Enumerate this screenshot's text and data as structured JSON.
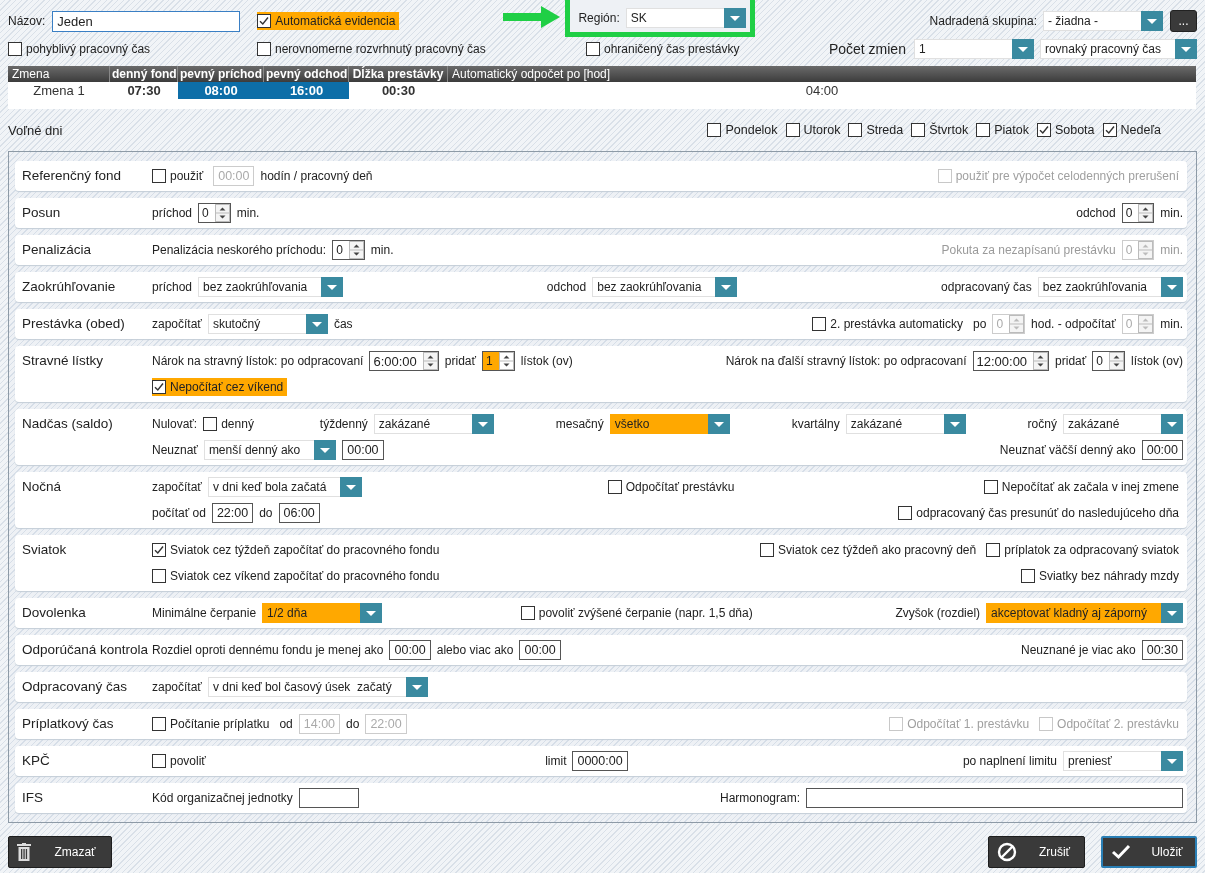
{
  "top": {
    "name_label": "Názov:",
    "name_value": "Jeden",
    "auto_evidence": {
      "label": "Automatická evidencia",
      "checked": true,
      "highlighted": true
    },
    "region": {
      "label": "Región:",
      "value": "SK",
      "marked": true
    },
    "parent_group": {
      "label": "Nadradená skupina:",
      "value": "- žiadna -",
      "button": "..."
    },
    "options": [
      {
        "label": "pohyblivý pracovný čas",
        "checked": false
      },
      {
        "label": "nerovnomerne rozvrhnutý pracovný čas",
        "checked": false
      },
      {
        "label": "ohraničený čas prestávky",
        "checked": false
      }
    ],
    "shift_count": {
      "label": "Počet zmien",
      "value": "1",
      "mode": "rovnaký pracovný čas"
    }
  },
  "shifts": {
    "columns": [
      "Zmena",
      "denný fond",
      "pevný príchod",
      "pevný odchod",
      "Dĺžka prestávky",
      "Automatický odpočet po [hod]"
    ],
    "rows": [
      {
        "cells": [
          {
            "text": "Zmena 1",
            "highlighted": false
          },
          {
            "text": "07:30",
            "highlighted": false
          },
          {
            "text": "08:00",
            "highlighted": true
          },
          {
            "text": "16:00",
            "highlighted": true
          },
          {
            "text": "00:30",
            "highlighted": false
          },
          {
            "text": "04:00",
            "highlighted": false
          }
        ]
      }
    ]
  },
  "free_days": {
    "label": "Voľné dni",
    "days": [
      {
        "label": "Pondelok",
        "checked": false
      },
      {
        "label": "Utorok",
        "checked": false
      },
      {
        "label": "Streda",
        "checked": false
      },
      {
        "label": "Štvrtok",
        "checked": false
      },
      {
        "label": "Piatok",
        "checked": false
      },
      {
        "label": "Sobota",
        "checked": true
      },
      {
        "label": "Nedeľa",
        "checked": true
      }
    ]
  },
  "sections": [
    {
      "title": "Referenčný fond",
      "lines": [
        {
          "groups": [
            {
              "items": [
                {
                  "kind": "check",
                  "label": "použiť",
                  "checked": false,
                  "disabled": false
                },
                {
                  "kind": "time",
                  "value": "00:00",
                  "disabled": true
                },
                {
                  "kind": "text",
                  "text": "hodín / pracovný deň"
                }
              ]
            },
            {
              "items": [
                {
                  "kind": "check",
                  "label": "použiť pre výpočet celodenných prerušení",
                  "checked": false,
                  "disabled": true
                }
              ]
            }
          ]
        }
      ]
    },
    {
      "title": "Posun",
      "lines": [
        {
          "groups": [
            {
              "items": [
                {
                  "kind": "text",
                  "text": "príchod"
                },
                {
                  "kind": "spin",
                  "value": "0",
                  "disabled": false,
                  "highlighted": false
                },
                {
                  "kind": "text",
                  "text": "min."
                }
              ]
            },
            {
              "items": [
                {
                  "kind": "text",
                  "text": "odchod"
                },
                {
                  "kind": "spin",
                  "value": "0",
                  "disabled": false,
                  "highlighted": false
                },
                {
                  "kind": "text",
                  "text": "min."
                }
              ]
            }
          ]
        }
      ]
    },
    {
      "title": "Penalizácia",
      "lines": [
        {
          "groups": [
            {
              "items": [
                {
                  "kind": "text",
                  "text": "Penalizácia neskorého príchodu:"
                },
                {
                  "kind": "spin",
                  "value": "0",
                  "disabled": false,
                  "highlighted": false
                },
                {
                  "kind": "text",
                  "text": "min."
                }
              ]
            },
            {
              "items": [
                {
                  "kind": "dim",
                  "text": "Pokuta za nezapísanú prestávku"
                },
                {
                  "kind": "spin",
                  "value": "0",
                  "disabled": true,
                  "highlighted": false
                },
                {
                  "kind": "dim",
                  "text": "min."
                }
              ]
            }
          ]
        }
      ]
    },
    {
      "title": "Zaokrúhľovanie",
      "lines": [
        {
          "groups": [
            {
              "items": [
                {
                  "kind": "text",
                  "text": "príchod"
                },
                {
                  "kind": "select",
                  "value": "bez zaokrúhľovania",
                  "highlighted": false
                }
              ]
            },
            {
              "items": [
                {
                  "kind": "text",
                  "text": "odchod"
                },
                {
                  "kind": "select",
                  "value": "bez zaokrúhľovania",
                  "highlighted": false
                }
              ]
            },
            {
              "items": [
                {
                  "kind": "text",
                  "text": "odpracovaný čas"
                },
                {
                  "kind": "select",
                  "value": "bez zaokrúhľovania",
                  "highlighted": false
                }
              ]
            }
          ]
        }
      ]
    },
    {
      "title": "Prestávka (obed)",
      "lines": [
        {
          "groups": [
            {
              "items": [
                {
                  "kind": "text",
                  "text": "započítať"
                },
                {
                  "kind": "select",
                  "value": "skutočný",
                  "highlighted": false
                },
                {
                  "kind": "text",
                  "text": "čas"
                }
              ]
            },
            {
              "items": [
                {
                  "kind": "check",
                  "label": "2. prestávka automaticky",
                  "checked": false,
                  "disabled": false
                },
                {
                  "kind": "text",
                  "text": "po"
                },
                {
                  "kind": "spin",
                  "value": "0",
                  "disabled": true,
                  "highlighted": false
                },
                {
                  "kind": "text",
                  "text": "hod. - odpočítať"
                },
                {
                  "kind": "spin",
                  "value": "0",
                  "disabled": true,
                  "highlighted": false
                },
                {
                  "kind": "text",
                  "text": "min."
                }
              ]
            }
          ]
        }
      ]
    },
    {
      "title": "Stravné lístky",
      "lines": [
        {
          "groups": [
            {
              "items": [
                {
                  "kind": "text",
                  "text": "Nárok na stravný lístok: po odpracovaní"
                },
                {
                  "kind": "spin",
                  "value": "6:00:00",
                  "disabled": false,
                  "highlighted": false
                },
                {
                  "kind": "text",
                  "text": "pridať"
                },
                {
                  "kind": "spin",
                  "value": "1",
                  "disabled": false,
                  "highlighted": true
                },
                {
                  "kind": "text",
                  "text": "lístok (ov)"
                }
              ]
            },
            {
              "items": [
                {
                  "kind": "text",
                  "text": "Nárok na ďalší stravný lístok: po odpracovaní"
                },
                {
                  "kind": "spin",
                  "value": "12:00:00",
                  "disabled": false,
                  "highlighted": false
                },
                {
                  "kind": "text",
                  "text": "pridať"
                },
                {
                  "kind": "spin",
                  "value": "0",
                  "disabled": false,
                  "highlighted": false
                },
                {
                  "kind": "text",
                  "text": "lístok (ov)"
                }
              ]
            }
          ]
        },
        {
          "groups": [
            {
              "items": [
                {
                  "kind": "check",
                  "label": "Nepočítať cez víkend",
                  "checked": true,
                  "disabled": false,
                  "highlighted": true
                }
              ]
            }
          ]
        }
      ]
    },
    {
      "title": "Nadčas (saldo)",
      "lines": [
        {
          "groups": [
            {
              "items": [
                {
                  "kind": "text",
                  "text": "Nulovať:"
                },
                {
                  "kind": "check",
                  "label": "denný",
                  "checked": false,
                  "disabled": false
                }
              ]
            },
            {
              "items": [
                {
                  "kind": "text",
                  "text": "týždenný"
                },
                {
                  "kind": "select",
                  "value": "zakázané",
                  "highlighted": false
                }
              ]
            },
            {
              "items": [
                {
                  "kind": "text",
                  "text": "mesačný"
                },
                {
                  "kind": "select",
                  "value": "všetko",
                  "highlighted": true
                }
              ]
            },
            {
              "items": [
                {
                  "kind": "text",
                  "text": "kvartálny"
                },
                {
                  "kind": "select",
                  "value": "zakázané",
                  "highlighted": false
                }
              ]
            },
            {
              "items": [
                {
                  "kind": "text",
                  "text": "ročný"
                },
                {
                  "kind": "select",
                  "value": "zakázané",
                  "highlighted": false
                }
              ]
            }
          ]
        },
        {
          "groups": [
            {
              "items": [
                {
                  "kind": "text",
                  "text": "Neuznať"
                },
                {
                  "kind": "select",
                  "value": "menší denný ako",
                  "highlighted": false
                },
                {
                  "kind": "time",
                  "value": "00:00",
                  "disabled": false
                }
              ]
            },
            {
              "items": [
                {
                  "kind": "text",
                  "text": "Neuznať väčší denný ako"
                },
                {
                  "kind": "time",
                  "value": "00:00",
                  "disabled": false
                }
              ]
            }
          ]
        }
      ]
    },
    {
      "title": "Nočná",
      "lines": [
        {
          "groups": [
            {
              "items": [
                {
                  "kind": "text",
                  "text": "započítať"
                },
                {
                  "kind": "select",
                  "value": "v dni keď bola začatá",
                  "highlighted": false
                }
              ]
            },
            {
              "items": [
                {
                  "kind": "check",
                  "label": "Odpočítať prestávku",
                  "checked": false,
                  "disabled": false
                }
              ]
            },
            {
              "items": [
                {
                  "kind": "check",
                  "label": "Nepočítať ak začala v inej zmene",
                  "checked": false,
                  "disabled": false
                }
              ]
            }
          ]
        },
        {
          "groups": [
            {
              "items": [
                {
                  "kind": "text",
                  "text": "počítať od"
                },
                {
                  "kind": "time",
                  "value": "22:00",
                  "disabled": false
                },
                {
                  "kind": "text",
                  "text": "do"
                },
                {
                  "kind": "time",
                  "value": "06:00",
                  "disabled": false
                }
              ]
            },
            {
              "items": [
                {
                  "kind": "check",
                  "label": "odpracovaný čas presunúť do nasledujúceho dňa",
                  "checked": false,
                  "disabled": false
                }
              ]
            }
          ]
        }
      ]
    },
    {
      "title": "Sviatok",
      "lines": [
        {
          "groups": [
            {
              "items": [
                {
                  "kind": "check",
                  "label": "Sviatok cez týždeň započítať do pracovného fondu",
                  "checked": true,
                  "disabled": false
                }
              ]
            },
            {
              "items": [
                {
                  "kind": "check",
                  "label": "Sviatok cez týždeň ako pracovný deň",
                  "checked": false,
                  "disabled": false
                },
                {
                  "kind": "check",
                  "label": "príplatok za odpracovaný sviatok",
                  "checked": false,
                  "disabled": false
                }
              ]
            }
          ]
        },
        {
          "groups": [
            {
              "items": [
                {
                  "kind": "check",
                  "label": "Sviatok cez víkend započítať do pracovného fondu",
                  "checked": false,
                  "disabled": false
                }
              ]
            },
            {
              "items": [
                {
                  "kind": "check",
                  "label": "Sviatky bez náhrady mzdy",
                  "checked": false,
                  "disabled": false
                }
              ]
            }
          ]
        }
      ]
    },
    {
      "title": "Dovolenka",
      "lines": [
        {
          "groups": [
            {
              "items": [
                {
                  "kind": "text",
                  "text": "Minimálne čerpanie"
                },
                {
                  "kind": "select",
                  "value": "1/2 dňa",
                  "highlighted": true
                }
              ]
            },
            {
              "items": [
                {
                  "kind": "check",
                  "label": "povoliť zvýšené čerpanie (napr. 1,5 dňa)",
                  "checked": false,
                  "disabled": false
                }
              ]
            },
            {
              "items": [
                {
                  "kind": "text",
                  "text": "Zvyšok (rozdiel)"
                },
                {
                  "kind": "select",
                  "value": "akceptovať kladný aj záporný",
                  "highlighted": true
                }
              ]
            }
          ]
        }
      ]
    },
    {
      "title": "Odporúčaná kontrola",
      "lines": [
        {
          "groups": [
            {
              "items": [
                {
                  "kind": "text",
                  "text": "Rozdiel oproti dennému fondu je menej ako"
                },
                {
                  "kind": "time",
                  "value": "00:00",
                  "disabled": false
                },
                {
                  "kind": "text",
                  "text": "alebo viac ako"
                },
                {
                  "kind": "time",
                  "value": "00:00",
                  "disabled": false
                }
              ]
            },
            {
              "items": [
                {
                  "kind": "text",
                  "text": "Neuznané je viac ako"
                },
                {
                  "kind": "time",
                  "value": "00:30",
                  "disabled": false
                }
              ]
            }
          ]
        }
      ]
    },
    {
      "title": "Odpracovaný čas",
      "lines": [
        {
          "groups": [
            {
              "items": [
                {
                  "kind": "text",
                  "text": "započítať"
                },
                {
                  "kind": "select",
                  "value": "v dni keď bol časový úsek  začatý",
                  "highlighted": false
                }
              ]
            }
          ]
        }
      ]
    },
    {
      "title": "Príplatkový čas",
      "lines": [
        {
          "groups": [
            {
              "items": [
                {
                  "kind": "check",
                  "label": "Počítanie príplatku",
                  "checked": false,
                  "disabled": false
                },
                {
                  "kind": "text",
                  "text": "od"
                },
                {
                  "kind": "time",
                  "value": "14:00",
                  "disabled": true
                },
                {
                  "kind": "text",
                  "text": "do"
                },
                {
                  "kind": "time",
                  "value": "22:00",
                  "disabled": true
                }
              ]
            },
            {
              "items": [
                {
                  "kind": "check",
                  "label": "Odpočítať 1. prestávku",
                  "checked": false,
                  "disabled": true
                },
                {
                  "kind": "check",
                  "label": "Odpočítať 2. prestávku",
                  "checked": false,
                  "disabled": true
                }
              ]
            }
          ]
        }
      ]
    },
    {
      "title": "KPČ",
      "lines": [
        {
          "groups": [
            {
              "items": [
                {
                  "kind": "check",
                  "label": "povoliť",
                  "checked": false,
                  "disabled": false
                }
              ]
            },
            {
              "items": [
                {
                  "kind": "text",
                  "text": "limit"
                },
                {
                  "kind": "time",
                  "value": "0000:00",
                  "disabled": false
                }
              ]
            },
            {
              "items": [
                {
                  "kind": "text",
                  "text": "po naplnení limitu"
                },
                {
                  "kind": "select",
                  "value": "preniesť",
                  "highlighted": false
                }
              ]
            }
          ]
        }
      ]
    },
    {
      "title": "IFS",
      "lines": [
        {
          "groups": [
            {
              "items": [
                {
                  "kind": "text",
                  "text": "Kód organizačnej jednotky"
                },
                {
                  "kind": "field"
                }
              ]
            },
            {
              "items": [
                {
                  "kind": "text",
                  "text": "Harmonogram:"
                },
                {
                  "kind": "longfield"
                }
              ]
            }
          ]
        }
      ]
    }
  ],
  "buttons": [
    {
      "kind": "delete",
      "label": "Zmazať"
    },
    {
      "kind": "cancel",
      "label": "Zrušiť"
    },
    {
      "kind": "save",
      "label": "Uložiť"
    }
  ]
}
